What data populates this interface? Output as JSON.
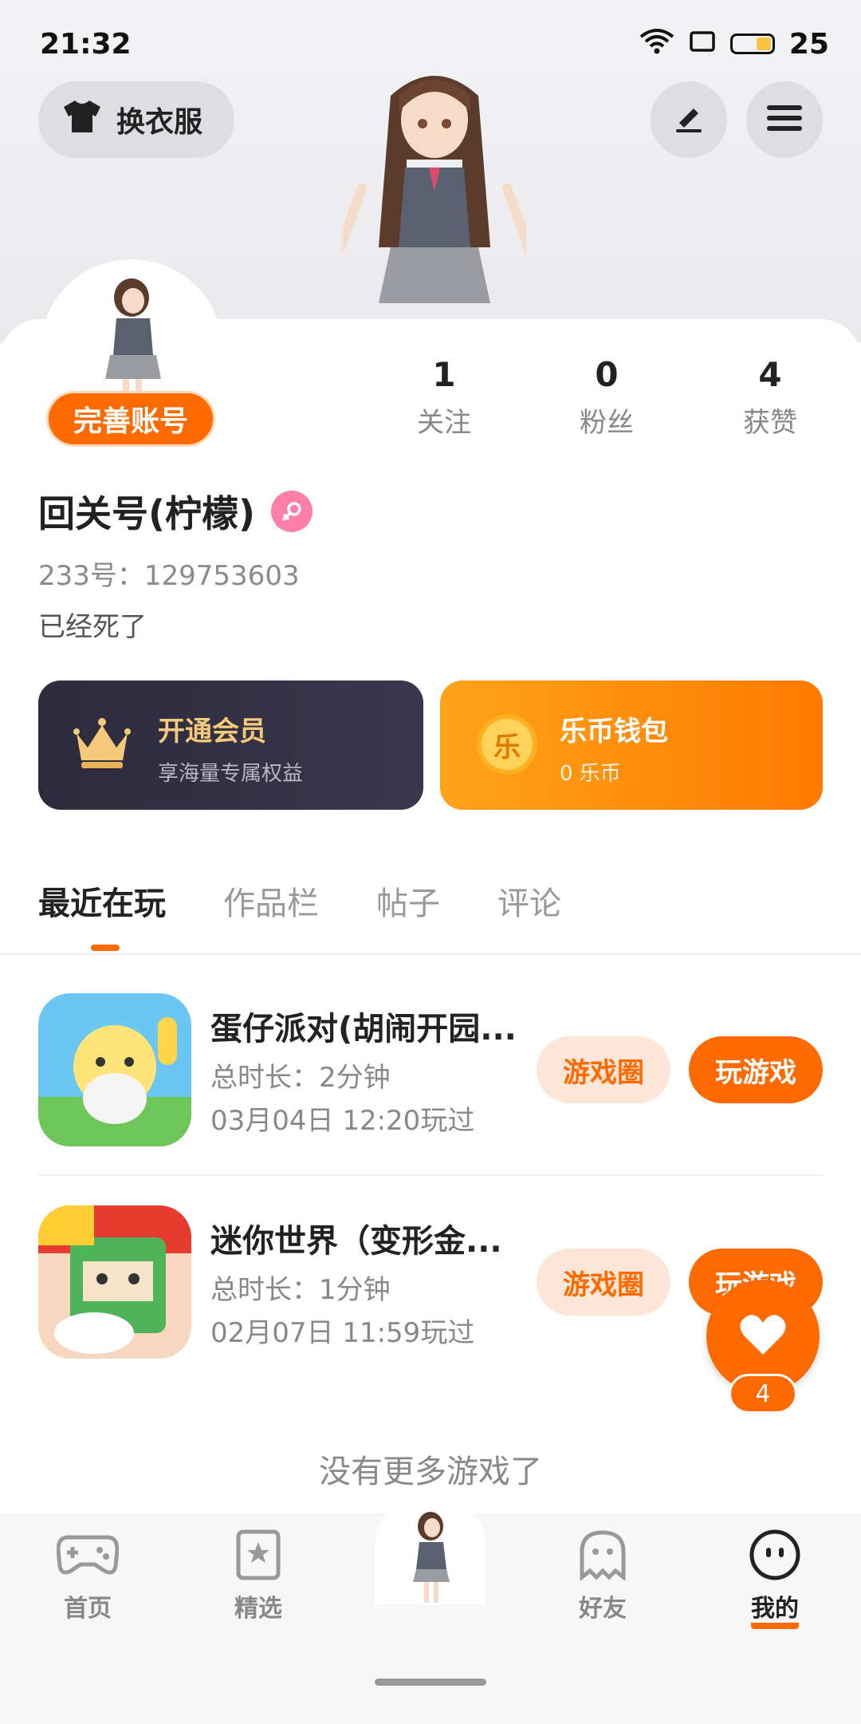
{
  "status_bar": {
    "time": "21:32",
    "battery": "25"
  },
  "header": {
    "outfit_label": "换衣服",
    "edit_icon": "pencil-icon",
    "menu_icon": "menu-icon"
  },
  "profile": {
    "complete_label": "完善账号",
    "stats": [
      {
        "value": "1",
        "label": "关注"
      },
      {
        "value": "0",
        "label": "粉丝"
      },
      {
        "value": "4",
        "label": "获赞"
      }
    ],
    "name": "回关号(柠檬)",
    "gender": "female",
    "uid": "233号：129753603",
    "bio": "已经死了"
  },
  "vip": {
    "title": "开通会员",
    "subtitle": "享海量专属权益"
  },
  "wallet": {
    "title": "乐币钱包",
    "subtitle": "0 乐币",
    "coin_char": "乐"
  },
  "tabs": [
    "最近在玩",
    "作品栏",
    "帖子",
    "评论"
  ],
  "games": [
    {
      "name": "蛋仔派对(胡闹开园...",
      "duration": "总时长：2分钟",
      "last_played": "03月04日 12:20玩过",
      "circle_label": "游戏圈",
      "play_label": "玩游戏"
    },
    {
      "name": "迷你世界（变形金...",
      "duration": "总时长：1分钟",
      "last_played": "02月07日 11:59玩过",
      "circle_label": "游戏圈",
      "play_label": "玩游戏"
    }
  ],
  "no_more": "没有更多游戏了",
  "like_count": "4",
  "nav": [
    {
      "label": "首页",
      "icon": "gamepad-icon"
    },
    {
      "label": "精选",
      "icon": "star-card-icon"
    },
    {
      "label": "",
      "icon": "avatar-center"
    },
    {
      "label": "好友",
      "icon": "ghost-icon"
    },
    {
      "label": "我的",
      "icon": "face-icon"
    }
  ],
  "colors": {
    "accent": "#ff6a00",
    "vip_bg": "#2c2a3c",
    "gold": "#f5c97a"
  }
}
